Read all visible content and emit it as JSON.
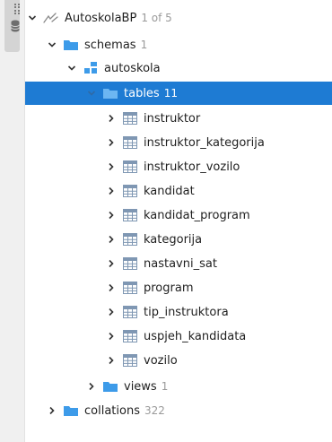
{
  "tree": {
    "connection": {
      "label": "AutoskolaBP",
      "count": "1 of 5"
    },
    "schemas": {
      "label": "schemas",
      "count": "1"
    },
    "schema": {
      "label": "autoskola"
    },
    "tables": {
      "label": "tables",
      "count": "11"
    },
    "table_items": [
      {
        "label": "instruktor"
      },
      {
        "label": "instruktor_kategorija"
      },
      {
        "label": "instruktor_vozilo"
      },
      {
        "label": "kandidat"
      },
      {
        "label": "kandidat_program"
      },
      {
        "label": "kategorija"
      },
      {
        "label": "nastavni_sat"
      },
      {
        "label": "program"
      },
      {
        "label": "tip_instruktora"
      },
      {
        "label": "uspjeh_kandidata"
      },
      {
        "label": "vozilo"
      }
    ],
    "views": {
      "label": "views",
      "count": "1"
    },
    "collations": {
      "label": "collations",
      "count": "322"
    }
  },
  "colors": {
    "selection": "#1e7bd3",
    "folder": "#3d9be9",
    "table_icon": "#7f97b3",
    "count": "#9a9a9a"
  }
}
